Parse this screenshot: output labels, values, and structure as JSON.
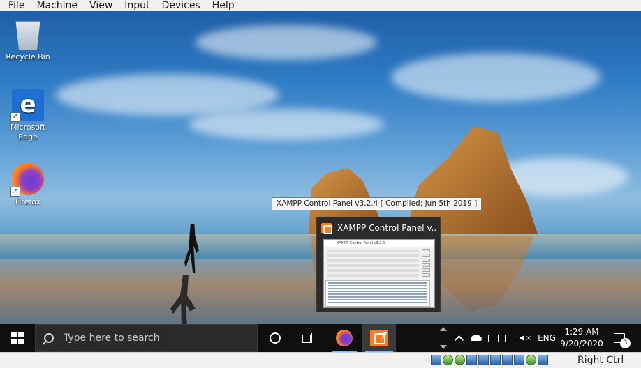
{
  "vm_menubar": {
    "items": [
      "File",
      "Machine",
      "View",
      "Input",
      "Devices",
      "Help"
    ]
  },
  "desktop": {
    "icons": [
      {
        "label": "Recycle Bin",
        "icon": "recycle-bin-icon"
      },
      {
        "label": "Microsoft Edge",
        "icon": "edge-icon"
      },
      {
        "label": "Firefox",
        "icon": "firefox-icon"
      }
    ]
  },
  "tooltip": {
    "text": "XAMPP Control Panel v3.2.4   [ Compiled: Jun 5th 2019 ]"
  },
  "thumbnail": {
    "title": "XAMPP Control Panel v...",
    "inner_title": "XAMPP Control Panel v3.2.4"
  },
  "taskbar": {
    "search_placeholder": "Type here to search",
    "apps": [
      {
        "name": "cortana",
        "icon": "cortana-icon"
      },
      {
        "name": "task-view",
        "icon": "task-view-icon"
      },
      {
        "name": "firefox",
        "icon": "firefox-icon"
      },
      {
        "name": "xampp",
        "icon": "xampp-icon",
        "active": true
      }
    ],
    "tray": {
      "language": "ENG",
      "time": "1:29 AM",
      "date": "9/20/2020",
      "notification_count": "3"
    }
  },
  "vm_statusbar": {
    "host_key": "Right Ctrl"
  },
  "colors": {
    "taskbar": "#0f0f0f",
    "accent_underline": "#76b9ed",
    "xampp_orange": "#fb7a24"
  }
}
